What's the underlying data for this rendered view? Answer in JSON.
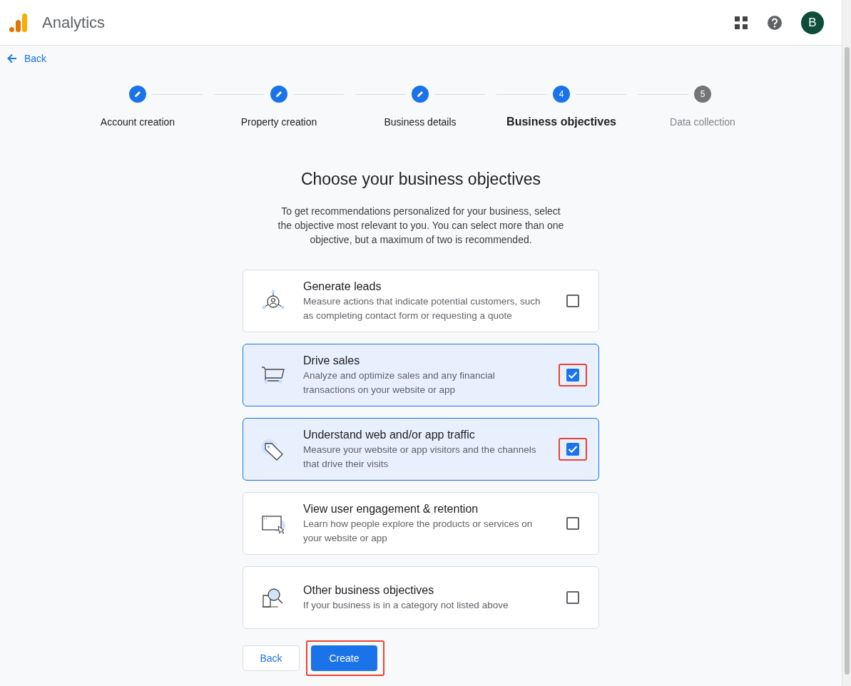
{
  "app": {
    "title": "Analytics",
    "avatar": "B"
  },
  "back_link": {
    "label": "Back"
  },
  "steps": [
    {
      "label": "Account creation",
      "completed": true,
      "selected": false
    },
    {
      "label": "Property creation",
      "completed": true,
      "selected": false
    },
    {
      "label": "Business details",
      "completed": true,
      "selected": false
    },
    {
      "label": "Business objectives",
      "completed": false,
      "selected": true,
      "number": "4"
    },
    {
      "label": "Data collection",
      "completed": false,
      "selected": false,
      "number": "5"
    }
  ],
  "heading": "Choose your business objectives",
  "intro": "To get recommendations personalized for your business, select the objective most relevant to you. You can select more than one objective, but a maximum of two is recommended.",
  "objectives": [
    {
      "kind": "leads",
      "title": "Generate leads",
      "description": "Measure actions that indicate potential customers, such as completing contact form or requesting a quote",
      "checked": false,
      "highlighted": false
    },
    {
      "kind": "sales",
      "title": "Drive sales",
      "description": "Analyze and optimize sales and any financial transactions on your website or app",
      "checked": true,
      "highlighted": true
    },
    {
      "kind": "traffic",
      "title": "Understand web and/or app traffic",
      "description": "Measure your website or app visitors and the channels that drive their visits",
      "checked": true,
      "highlighted": true
    },
    {
      "kind": "engagement",
      "title": "View user engagement & retention",
      "description": "Learn how people explore the products or services on your website or app",
      "checked": false,
      "highlighted": false
    },
    {
      "kind": "other",
      "title": "Other business objectives",
      "description": "If your business is in a category not listed above",
      "checked": false,
      "highlighted": false
    }
  ],
  "buttons": [
    {
      "label": "Back",
      "kind": "secondary",
      "highlighted": false
    },
    {
      "label": "Create",
      "kind": "primary",
      "highlighted": true
    }
  ]
}
